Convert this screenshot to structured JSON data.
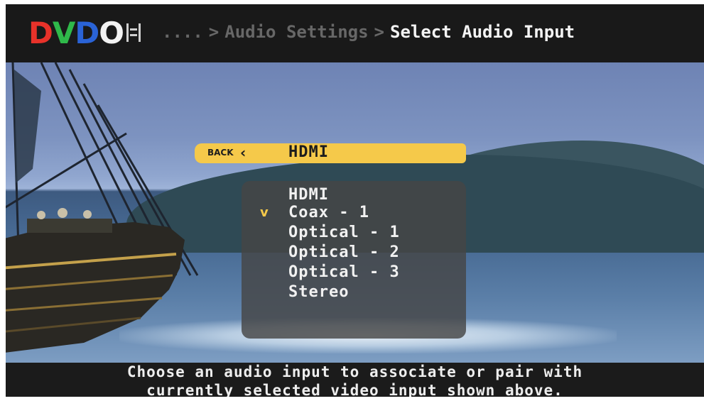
{
  "header": {
    "logo_text": "DVDO",
    "logo_colors": [
      "#e8322a",
      "#2fb94a",
      "#2a63d6",
      "#f2f2f2"
    ],
    "breadcrumb": {
      "ellipsis": "....",
      "separator": ">",
      "parent": "Audio Settings",
      "current": "Select Audio Input"
    }
  },
  "menu": {
    "back_label": "BACK",
    "back_icon": "chevron-left-icon",
    "items": [
      {
        "label": "HDMI",
        "highlighted": true,
        "checked": false
      },
      {
        "label": "Coax - 1",
        "highlighted": false,
        "checked": true
      },
      {
        "label": "Optical - 1",
        "highlighted": false,
        "checked": false
      },
      {
        "label": "Optical - 2",
        "highlighted": false,
        "checked": false
      },
      {
        "label": "Optical - 3",
        "highlighted": false,
        "checked": false
      },
      {
        "label": "Stereo",
        "highlighted": false,
        "checked": false
      }
    ],
    "check_glyph": "v",
    "highlight_color": "#f5c94a"
  },
  "footer": {
    "line1": "Choose an audio input to associate or pair with",
    "line2": "currently selected video input shown above."
  }
}
